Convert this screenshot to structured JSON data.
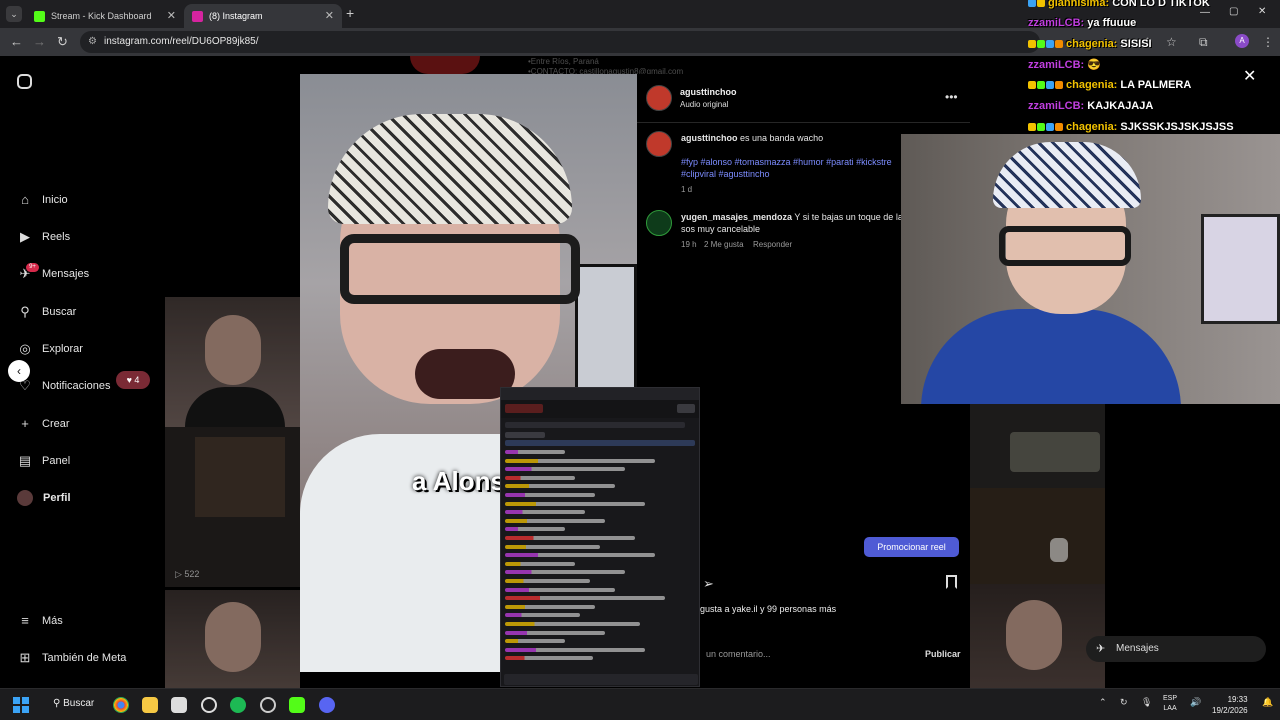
{
  "browser": {
    "tabs": [
      {
        "title": "Stream - Kick Dashboard",
        "favicon_color": "#53fc18",
        "active": false
      },
      {
        "title": "(8) Instagram",
        "favicon_color": "#d6249f",
        "active": true
      }
    ],
    "url": "instagram.com/reel/DU6OP89jk85/"
  },
  "sidebar": {
    "items": [
      {
        "label": "Inicio",
        "icon": "home-icon"
      },
      {
        "label": "Reels",
        "icon": "reels-icon"
      },
      {
        "label": "Mensajes",
        "icon": "messages-icon"
      },
      {
        "label": "Buscar",
        "icon": "search-icon"
      },
      {
        "label": "Explorar",
        "icon": "explore-icon"
      },
      {
        "label": "Notificaciones",
        "icon": "heart-icon"
      },
      {
        "label": "Crear",
        "icon": "plus-icon"
      },
      {
        "label": "Panel",
        "icon": "panel-icon"
      },
      {
        "label": "Perfil",
        "icon": "avatar"
      },
      {
        "label": "Más",
        "icon": "menu-icon"
      },
      {
        "label": "También de Meta",
        "icon": "meta-icon"
      }
    ],
    "messages_badge": "9+",
    "notifications_badge": "♥ 4"
  },
  "reel": {
    "caption_overlay": "a Alons",
    "views": "522"
  },
  "post": {
    "author": "agusttinchoo",
    "audio": "Audio original",
    "caption_user": "agusttinchoo",
    "caption_text": "es una banda wacho",
    "hashtags_line1": "#fyp #alonso #tomasmazza #humor #parati #kickstre",
    "hashtags_line2": "#clipviral #agusttincho",
    "caption_age": "1 d",
    "comment_user": "yugen_masajes_mendoza",
    "comment_text_1": "Y si te bajas un toque de la",
    "comment_text_2": "sos muy cancelable",
    "comment_age": "19 h",
    "comment_likes": "2 Me gusta",
    "comment_reply": "Responder",
    "promote_label": "Promocionar reel",
    "likes_text": "gusta a yake.il y 99 personas más",
    "comment_placeholder": "un comentario...",
    "publish_label": "Publicar",
    "messages_label": "Mensajes"
  },
  "bg_profile": {
    "line1": "•Entre Ríos, Paraná",
    "line2": "•CONTACTO: castillonagustin8@gmail.com"
  },
  "stream_chat": [
    {
      "user": "giannisima:",
      "msg": "CON LO D TIKTOK",
      "color": "#f2c200"
    },
    {
      "user": "zzamiLCB:",
      "msg": "ya ffuuue",
      "color": "#c13fe0"
    },
    {
      "user": "chagenia:",
      "msg": "SISISI",
      "color": "#f2c200"
    },
    {
      "user": "zzamiLCB:",
      "msg": "😎",
      "color": "#c13fe0"
    },
    {
      "user": "chagenia:",
      "msg": "LA PALMERA",
      "color": "#f2c200"
    },
    {
      "user": "zzamiLCB:",
      "msg": "KAJKAJAJA",
      "color": "#c13fe0"
    },
    {
      "user": "chagenia:",
      "msg": "SJKSSKJSJSKJSJSS",
      "color": "#f2c200"
    }
  ],
  "taskbar": {
    "search_label": "Buscar",
    "lang_1": "ESP",
    "lang_2": "LAA",
    "time": "19:33",
    "date": "19/2/2026"
  }
}
